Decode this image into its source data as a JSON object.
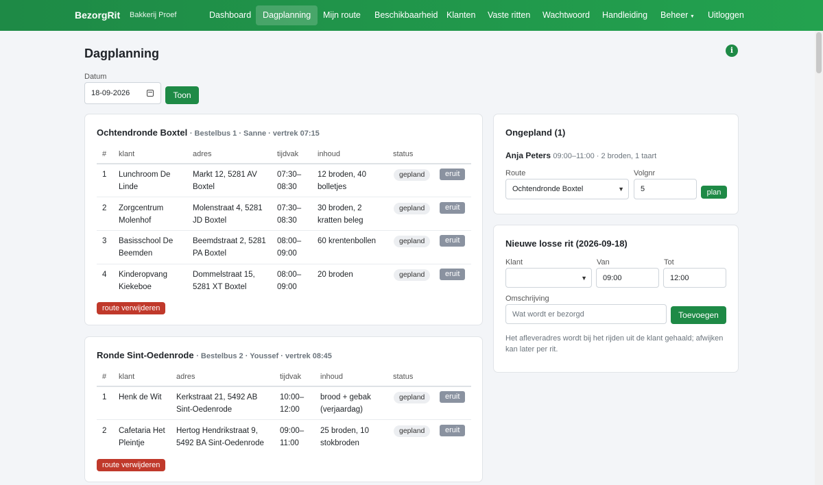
{
  "nav": {
    "brand": "BezorgRit",
    "brand_sub": "Bakkerij Proef",
    "items": [
      "Dashboard",
      "Dagplanning",
      "Mijn route",
      "Beschikbaarheid",
      "Klanten",
      "Vaste ritten",
      "Wachtwoord",
      "Handleiding",
      "Beheer",
      "Uitloggen"
    ]
  },
  "page": {
    "title": "Dagplanning",
    "date_label": "Datum",
    "date_value": "18-09-2026",
    "show_button": "Toon"
  },
  "table_headers": [
    "#",
    "klant",
    "adres",
    "tijdvak",
    "inhoud",
    "status"
  ],
  "routes": [
    {
      "name": "Ochtendronde Boxtel",
      "meta": "· Bestelbus 1 · Sanne · vertrek 07:15",
      "delete_label": "route verwijderen",
      "rows": [
        {
          "nr": "1",
          "klant": [
            "Lunchroom De",
            "Linde"
          ],
          "adres": [
            "Markt 12, 5281 AV",
            "Boxtel"
          ],
          "tijdvak": [
            "07:30–",
            "08:30"
          ],
          "inhoud": [
            "12 broden, 40",
            "bolletjes"
          ],
          "status": "gepland",
          "action": "eruit"
        },
        {
          "nr": "2",
          "klant": [
            "Zorgcentrum",
            "Molenhof"
          ],
          "adres": [
            "Molenstraat 4, 5281",
            "JD Boxtel"
          ],
          "tijdvak": [
            "07:30–",
            "08:30"
          ],
          "inhoud": [
            "30 broden, 2",
            "kratten beleg"
          ],
          "status": "gepland",
          "action": "eruit"
        },
        {
          "nr": "3",
          "klant": [
            "Basisschool De",
            "Beemden"
          ],
          "adres": [
            "Beemdstraat 2, 5281",
            "PA Boxtel"
          ],
          "tijdvak": [
            "08:00–",
            "09:00"
          ],
          "inhoud": [
            "60 krentenbollen",
            ""
          ],
          "status": "gepland",
          "action": "eruit"
        },
        {
          "nr": "4",
          "klant": [
            "Kinderopvang",
            "Kiekeboe"
          ],
          "adres": [
            "Dommelstraat 15,",
            "5281 XT Boxtel"
          ],
          "tijdvak": [
            "08:00–",
            "09:00"
          ],
          "inhoud": [
            "20 broden",
            ""
          ],
          "status": "gepland",
          "action": "eruit"
        }
      ]
    },
    {
      "name": "Ronde Sint-Oedenrode",
      "meta": "· Bestelbus 2 · Youssef · vertrek 08:45",
      "delete_label": "route verwijderen",
      "rows": [
        {
          "nr": "1",
          "klant": [
            "Henk de Wit",
            ""
          ],
          "adres": [
            "Kerkstraat 21, 5492 AB",
            "Sint-Oedenrode"
          ],
          "tijdvak": [
            "10:00–",
            "12:00"
          ],
          "inhoud": [
            "brood + gebak",
            "(verjaardag)"
          ],
          "status": "gepland",
          "action": "eruit"
        },
        {
          "nr": "2",
          "klant": [
            "Cafetaria Het",
            "Pleintje"
          ],
          "adres": [
            "Hertog Hendrikstraat 9,",
            "5492 BA Sint-Oedenrode"
          ],
          "tijdvak": [
            "09:00–",
            "11:00"
          ],
          "inhoud": [
            "25 broden, 10",
            "stokbroden"
          ],
          "status": "gepland",
          "action": "eruit"
        }
      ]
    }
  ],
  "unplanned": {
    "title": "Ongepland (1)",
    "customer": "Anja Peters",
    "details": "09:00–11:00 · 2 broden, 1 taart",
    "route_label": "Route",
    "route_value": "Ochtendronde Boxtel",
    "volgnr_label": "Volgnr",
    "volgnr_value": "5",
    "plan_button": "plan"
  },
  "new_ride": {
    "title": "Nieuwe losse rit (2026-09-18)",
    "klant_label": "Klant",
    "klant_value": "",
    "van_label": "Van",
    "van_value": "09:00",
    "tot_label": "Tot",
    "tot_value": "12:00",
    "omschrijving_label": "Omschrijving",
    "omschrijving_placeholder": "Wat wordt er bezorgd",
    "add_button": "Toevoegen",
    "help_line1": "Het afleveradres wordt bij het rijden uit de klant gehaald; afwijken",
    "help_line2": "kan later per rit."
  }
}
